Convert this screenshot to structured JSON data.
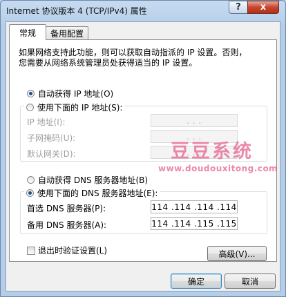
{
  "window": {
    "title": "Internet 协议版本 4 (TCP/IPv4) 属性",
    "help_symbol": "?",
    "close_symbol": "x"
  },
  "tabs": [
    {
      "label": "常规",
      "active": true
    },
    {
      "label": "备用配置",
      "active": false
    }
  ],
  "intro": {
    "line1": "如果网络支持此功能，则可以获取自动指派的 IP 设置。否则，",
    "line2": "您需要从网络系统管理员处获得适当的 IP 设置。"
  },
  "ip_section": {
    "auto_ip_label": "自动获得 IP 地址(O)",
    "auto_ip_selected": true,
    "manual_ip_label": "使用下面的 IP 地址(S):",
    "manual_ip_selected": false,
    "fields": [
      {
        "label": "IP 地址(I):",
        "value": ".   .   .",
        "enabled": false
      },
      {
        "label": "子网掩码(U):",
        "value": ".   .   .",
        "enabled": false
      },
      {
        "label": "默认网关(D):",
        "value": ".   .   .",
        "enabled": false
      }
    ]
  },
  "dns_section": {
    "auto_dns_label": "自动获得 DNS 服务器地址(B)",
    "auto_dns_selected": false,
    "manual_dns_label": "使用下面的 DNS 服务器地址(E):",
    "manual_dns_selected": true,
    "preferred": {
      "label": "首选 DNS 服务器(P):",
      "value": "114 .114 .114 .114"
    },
    "alternate": {
      "label": "备用 DNS 服务器(A):",
      "value": "114 .114 .115 .115"
    }
  },
  "validate_on_exit": {
    "label": "退出时验证设置(L)",
    "checked": false
  },
  "buttons": {
    "advanced": "高级(V)...",
    "ok": "确定",
    "cancel": "取消"
  },
  "watermark": {
    "text": "豆豆系统",
    "url": "www.doudouxitong.com"
  }
}
